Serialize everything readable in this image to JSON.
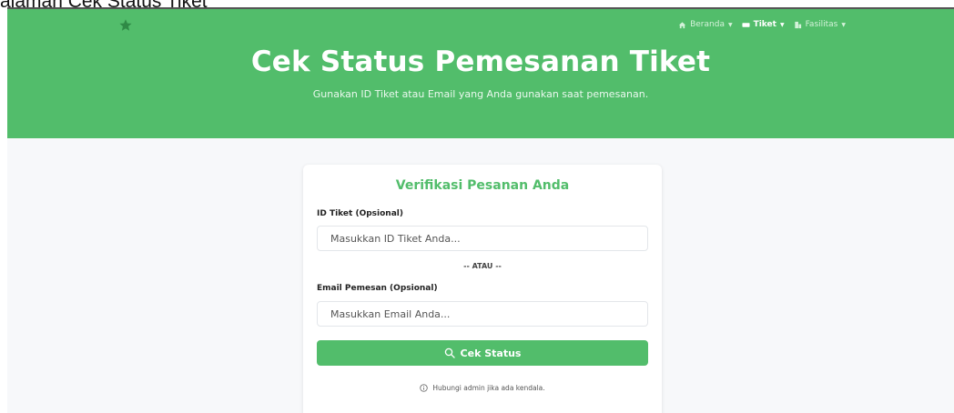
{
  "document": {
    "caption": "alaman Cek Status Tiket"
  },
  "nav": {
    "items": [
      {
        "label": "Beranda",
        "icon": "home-icon",
        "active": false
      },
      {
        "label": "Tiket",
        "icon": "ticket-icon",
        "active": true
      },
      {
        "label": "Fasilitas",
        "icon": "building-icon",
        "active": false
      }
    ]
  },
  "hero": {
    "title": "Cek Status Pemesanan Tiket",
    "subtitle": "Gunakan ID Tiket atau Email yang Anda gunakan saat pemesanan."
  },
  "form": {
    "title": "Verifikasi Pesanan Anda",
    "id_label": "ID Tiket (Opsional)",
    "id_placeholder": "Masukkan ID Tiket Anda...",
    "separator": "-- ATAU --",
    "email_label": "Email Pemesan (Opsional)",
    "email_placeholder": "Masukkan Email Anda...",
    "submit_label": "Cek Status",
    "help_text": "Hubungi admin jika ada kendala."
  },
  "colors": {
    "accent": "#52bd6b",
    "background": "#f7f8fa",
    "card": "#ffffff"
  }
}
